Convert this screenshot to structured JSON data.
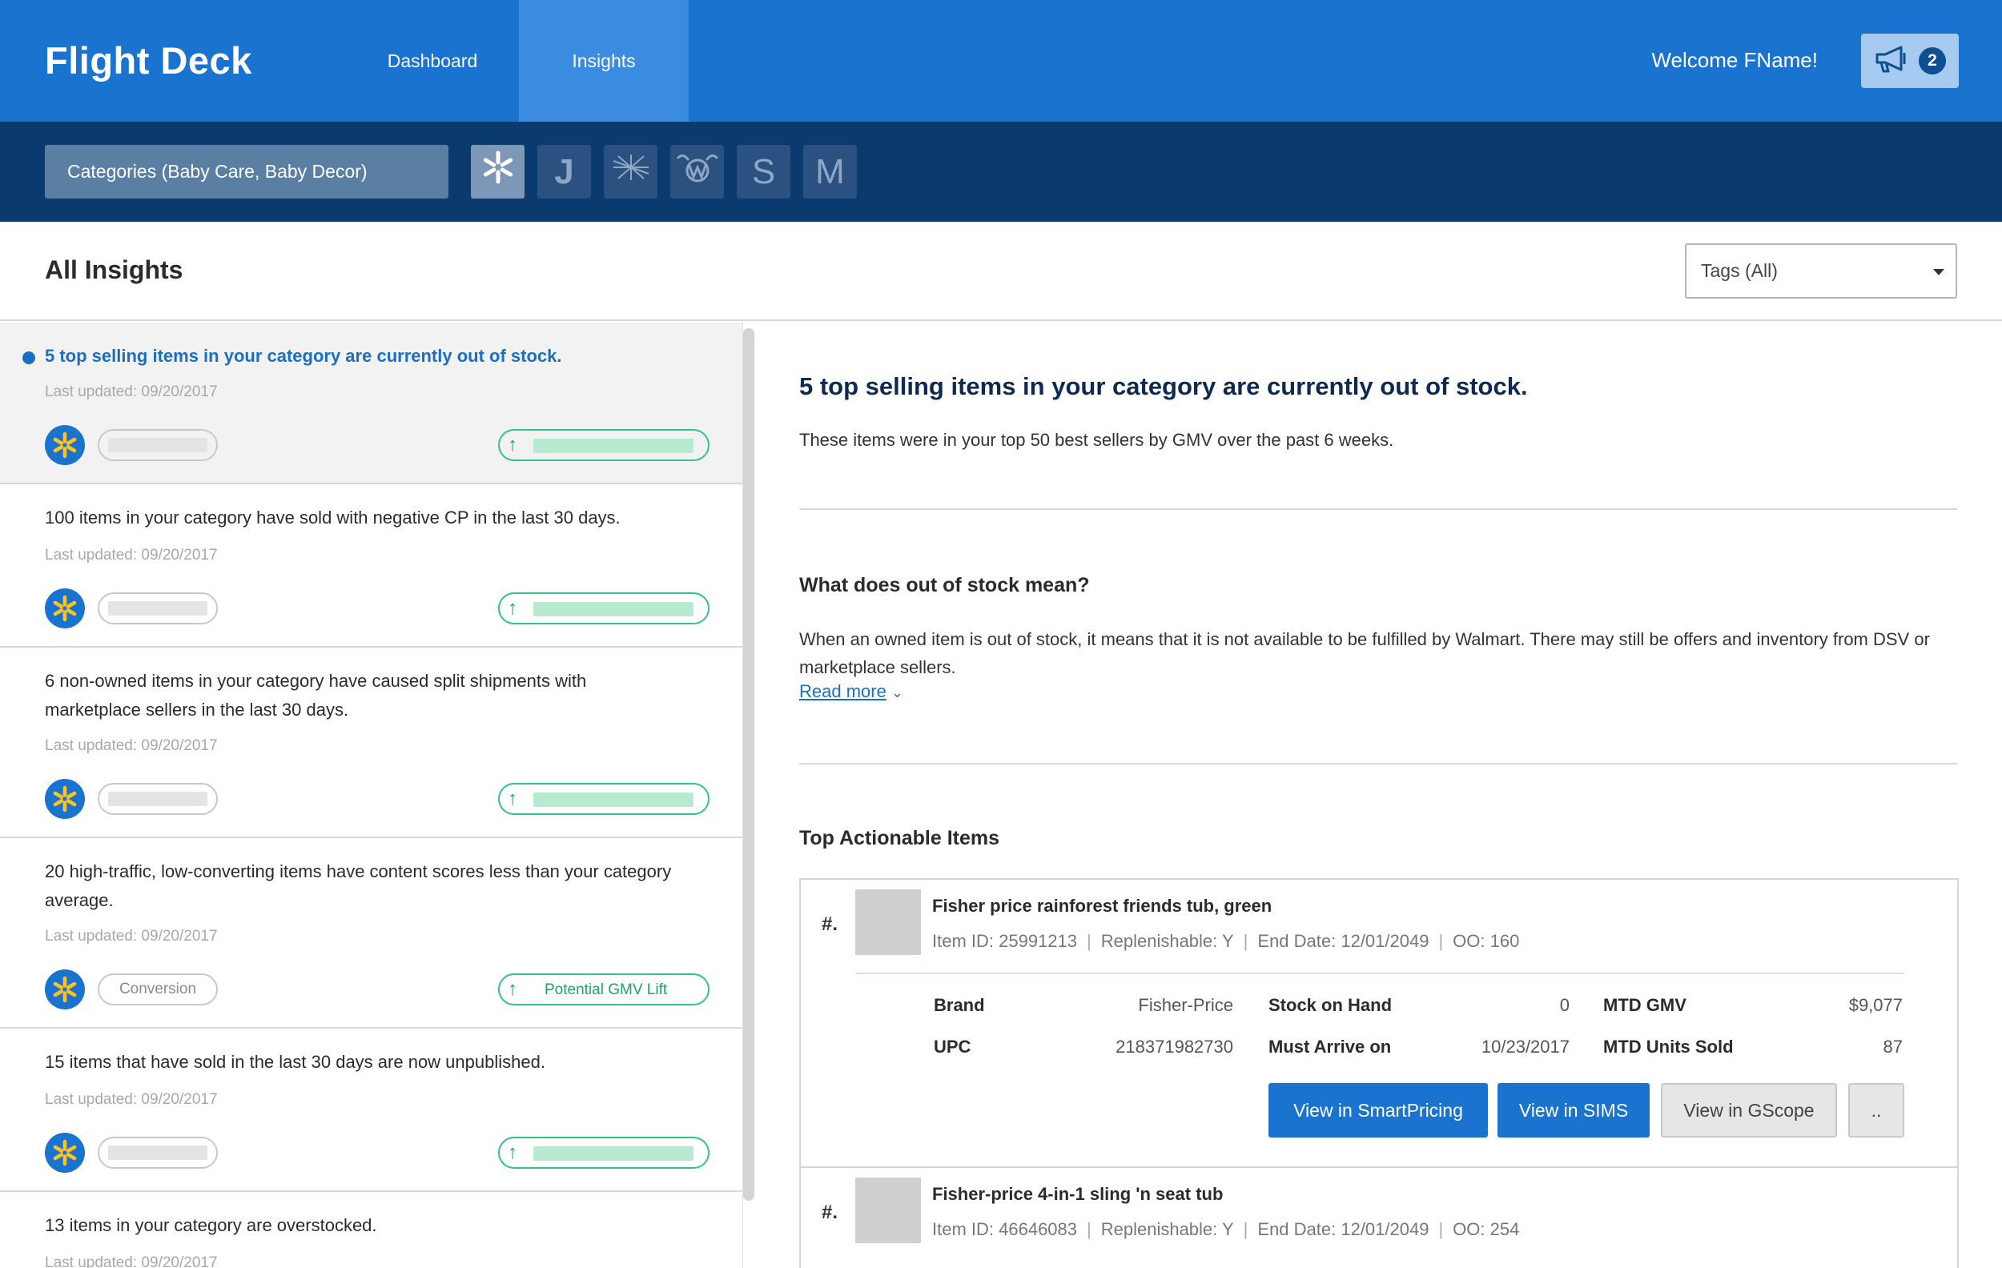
{
  "app": {
    "title": "Flight Deck",
    "welcome": "Welcome FName!",
    "notification_count": "2"
  },
  "nav": {
    "tabs": [
      {
        "label": "Dashboard",
        "active": false
      },
      {
        "label": "Insights",
        "active": true
      }
    ]
  },
  "filters": {
    "category_label": "Categories (Baby Care, Baby Decor)",
    "banners": [
      {
        "icon": "walmart-spark-icon",
        "glyph": "",
        "active": true
      },
      {
        "icon": "jet-icon",
        "glyph": "J",
        "active": false
      },
      {
        "icon": "hayneedle-icon",
        "glyph": "",
        "active": false
      },
      {
        "icon": "wine-icon",
        "glyph": "",
        "active": false
      },
      {
        "icon": "shoes-icon",
        "glyph": "S",
        "active": false
      },
      {
        "icon": "modcloth-icon",
        "glyph": "M",
        "active": false
      }
    ]
  },
  "page": {
    "title": "All Insights",
    "tags_label": "Tags (All)"
  },
  "insights": [
    {
      "title": "5 top selling items in your category are currently out of stock.",
      "updated": "Last updated: 09/20/2017",
      "tag": "",
      "lift": "",
      "selected": true
    },
    {
      "title": "100 items in your category have sold with negative CP in the last 30 days.",
      "updated": "Last updated: 09/20/2017",
      "tag": "",
      "lift": "",
      "selected": false
    },
    {
      "title": "6 non-owned items in your category have caused split shipments with marketplace sellers in the last 30 days.",
      "updated": "Last updated: 09/20/2017",
      "tag": "",
      "lift": "",
      "selected": false
    },
    {
      "title": "20 high-traffic, low-converting items have content scores less than your category average.",
      "updated": "Last updated: 09/20/2017",
      "tag": "Conversion",
      "lift": "Potential GMV Lift",
      "selected": false
    },
    {
      "title": "15 items that have sold in the last 30 days are now unpublished.",
      "updated": "Last updated: 09/20/2017",
      "tag": "",
      "lift": "",
      "selected": false
    },
    {
      "title": "13 items in your category are overstocked.",
      "updated": "Last updated: 09/20/2017",
      "tag": "",
      "lift": "",
      "selected": false
    }
  ],
  "detail": {
    "title": "5 top selling items in your category are currently out of stock.",
    "subtitle": "These items were in your top 50 best sellers by GMV over the past 6 weeks.",
    "question": "What does out of stock mean?",
    "explanation": "When an owned item is out of stock, it means that it is not available to be fulfilled by Walmart. There may still be offers and inventory from DSV or marketplace sellers.",
    "read_more": "Read more",
    "items_heading": "Top Actionable Items",
    "items": [
      {
        "num": "#.",
        "name": "Fisher price rainforest friends tub, green",
        "item_id": "Item ID: 25991213",
        "replenishable": "Replenishable: Y",
        "end_date": "End Date: 12/01/2049",
        "oo": "OO: 160",
        "brand_label": "Brand",
        "brand": "Fisher-Price",
        "upc_label": "UPC",
        "upc": "218371982730",
        "soh_label": "Stock on Hand",
        "soh": "0",
        "arrive_label": "Must Arrive on",
        "arrive": "10/23/2017",
        "gmv_label": "MTD GMV",
        "gmv": "$9,077",
        "units_label": "MTD Units Sold",
        "units": "87"
      },
      {
        "num": "#.",
        "name": "Fisher-price 4-in-1 sling 'n seat tub",
        "item_id": "Item ID: 46646083",
        "replenishable": "Replenishable: Y",
        "end_date": "End Date: 12/01/2049",
        "oo": "OO: 254"
      }
    ],
    "actions": {
      "smartpricing": "View in SmartPricing",
      "sims": "View in SIMS",
      "gscope": "View in GScope",
      "more": ".."
    }
  },
  "colors": {
    "header": "#1a73cf",
    "subheader": "#0b3b6e",
    "accent": "#1a6fc4",
    "lift_green": "#33c28a"
  }
}
